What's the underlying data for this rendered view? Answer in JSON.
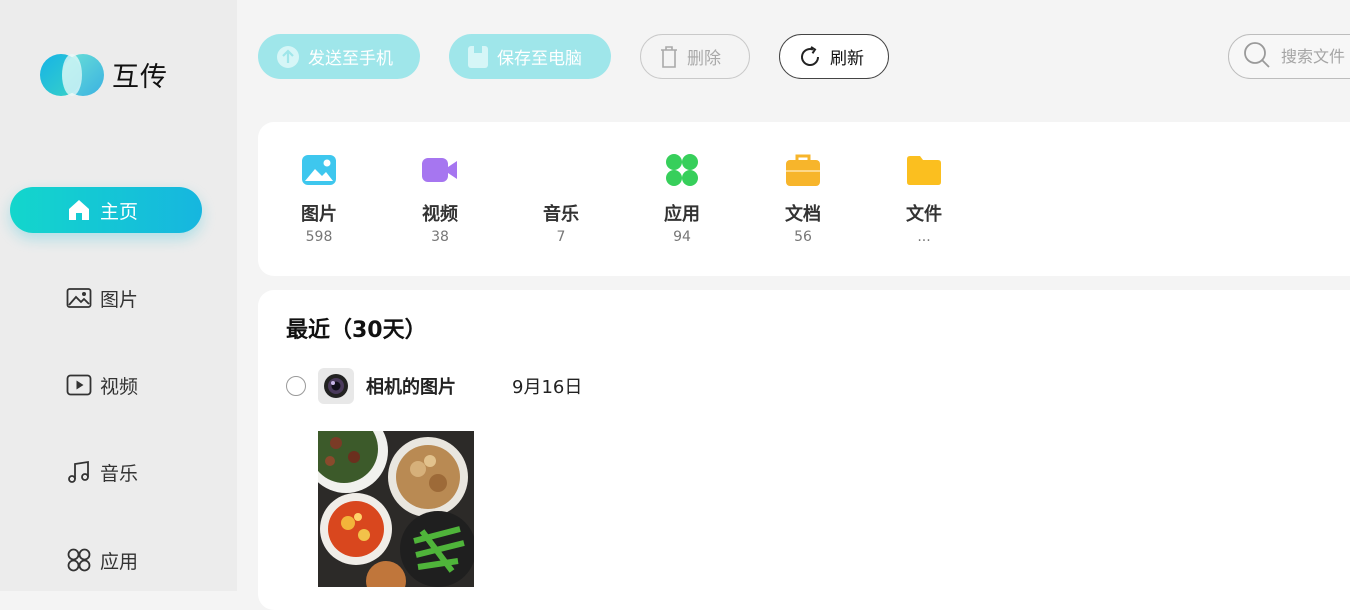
{
  "app": {
    "name": "互传"
  },
  "sidebar": {
    "items": [
      {
        "label": "主页",
        "icon": "home-icon",
        "active": true
      },
      {
        "label": "图片",
        "icon": "image-icon",
        "active": false
      },
      {
        "label": "视频",
        "icon": "video-icon",
        "active": false
      },
      {
        "label": "音乐",
        "icon": "music-icon",
        "active": false
      },
      {
        "label": "应用",
        "icon": "apps-icon",
        "active": false
      }
    ]
  },
  "toolbar": {
    "send_label": "发送至手机",
    "save_label": "保存至电脑",
    "delete_label": "删除",
    "refresh_label": "刷新",
    "search_placeholder": "搜索文件",
    "accent": "#9fe6ea"
  },
  "categories": [
    {
      "name": "图片",
      "count": "598",
      "icon": "image-icon",
      "color": "#3ec7ee"
    },
    {
      "name": "视频",
      "count": "38",
      "icon": "video-icon",
      "color": "#a676f0"
    },
    {
      "name": "音乐",
      "count": "7",
      "icon": "music-icon",
      "color": "#ffffff"
    },
    {
      "name": "应用",
      "count": "94",
      "icon": "apps-icon",
      "color": "#37cf5b"
    },
    {
      "name": "文档",
      "count": "56",
      "icon": "briefcase-icon",
      "color": "#f7b52b"
    },
    {
      "name": "文件",
      "count": "...",
      "icon": "folder-icon",
      "color": "#fbbf1f"
    }
  ],
  "recent": {
    "title": "最近（30天）",
    "groups": [
      {
        "name": "相机的图片",
        "date": "9月16日",
        "icon": "camera-icon"
      }
    ]
  }
}
